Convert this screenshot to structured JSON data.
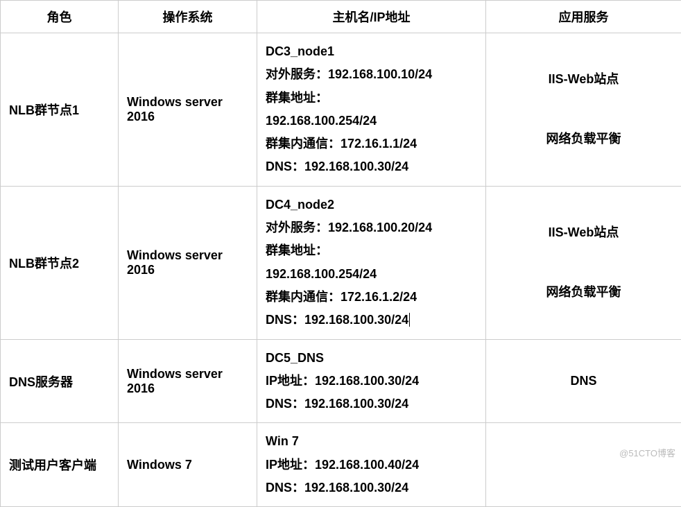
{
  "chart_data": {
    "type": "table",
    "columns": [
      "角色",
      "操作系统",
      "主机名/IP地址",
      "应用服务"
    ],
    "rows": [
      {
        "role": "NLB群节点1",
        "os": "Windows server 2016",
        "host": [
          "DC3_node1",
          "对外服务：192.168.100.10/24",
          "群集地址：",
          "192.168.100.254/24",
          "群集内通信：172.16.1.1/24",
          "DNS：192.168.100.30/24"
        ],
        "app": [
          "IIS-Web站点",
          "",
          "网络负载平衡"
        ]
      },
      {
        "role": "NLB群节点2",
        "os": "Windows server 2016",
        "host": [
          "DC4_node2",
          "对外服务：192.168.100.20/24",
          "群集地址：",
          "192.168.100.254/24",
          "群集内通信：172.16.1.2/24",
          "DNS：192.168.100.30/24"
        ],
        "app": [
          "IIS-Web站点",
          "",
          "网络负载平衡"
        ]
      },
      {
        "role": "DNS服务器",
        "os": "Windows server 2016",
        "host": [
          "DC5_DNS",
          "IP地址：192.168.100.30/24",
          "DNS：192.168.100.30/24"
        ],
        "app": [
          "DNS"
        ]
      },
      {
        "role": "测试用户客户端",
        "os": "Windows 7",
        "host": [
          "Win 7",
          "IP地址：192.168.100.40/24",
          "DNS：192.168.100.30/24"
        ],
        "app": []
      }
    ]
  },
  "headers": {
    "c1": "角色",
    "c2": "操作系统",
    "c3": "主机名/IP地址",
    "c4": "应用服务"
  },
  "row1": {
    "role": "NLB群节点1",
    "os": "Windows server 2016",
    "h0": "DC3_node1",
    "h1": "对外服务：192.168.100.10/24",
    "h2": "群集地址：",
    "h3": "192.168.100.254/24",
    "h4": "群集内通信：172.16.1.1/24",
    "h5": "DNS：192.168.100.30/24",
    "a0": "IIS-Web站点",
    "a1": "",
    "a2": "网络负载平衡"
  },
  "row2": {
    "role": "NLB群节点2",
    "os": "Windows server 2016",
    "h0": "DC4_node2",
    "h1": "对外服务：192.168.100.20/24",
    "h2": "群集地址：",
    "h3": "192.168.100.254/24",
    "h4": "群集内通信：172.16.1.2/24",
    "h5": "DNS：192.168.100.30/24",
    "a0": "IIS-Web站点",
    "a1": "",
    "a2": "网络负载平衡"
  },
  "row3": {
    "role": "DNS服务器",
    "os": "Windows server 2016",
    "h0": "DC5_DNS",
    "h1": "IP地址：192.168.100.30/24",
    "h2": "DNS：192.168.100.30/24",
    "a0": "DNS"
  },
  "row4": {
    "role": "测试用户客户端",
    "os": "Windows 7",
    "h0": "Win 7",
    "h1": "IP地址：192.168.100.40/24",
    "h2": "DNS：192.168.100.30/24"
  },
  "watermark": "@51CTO博客"
}
